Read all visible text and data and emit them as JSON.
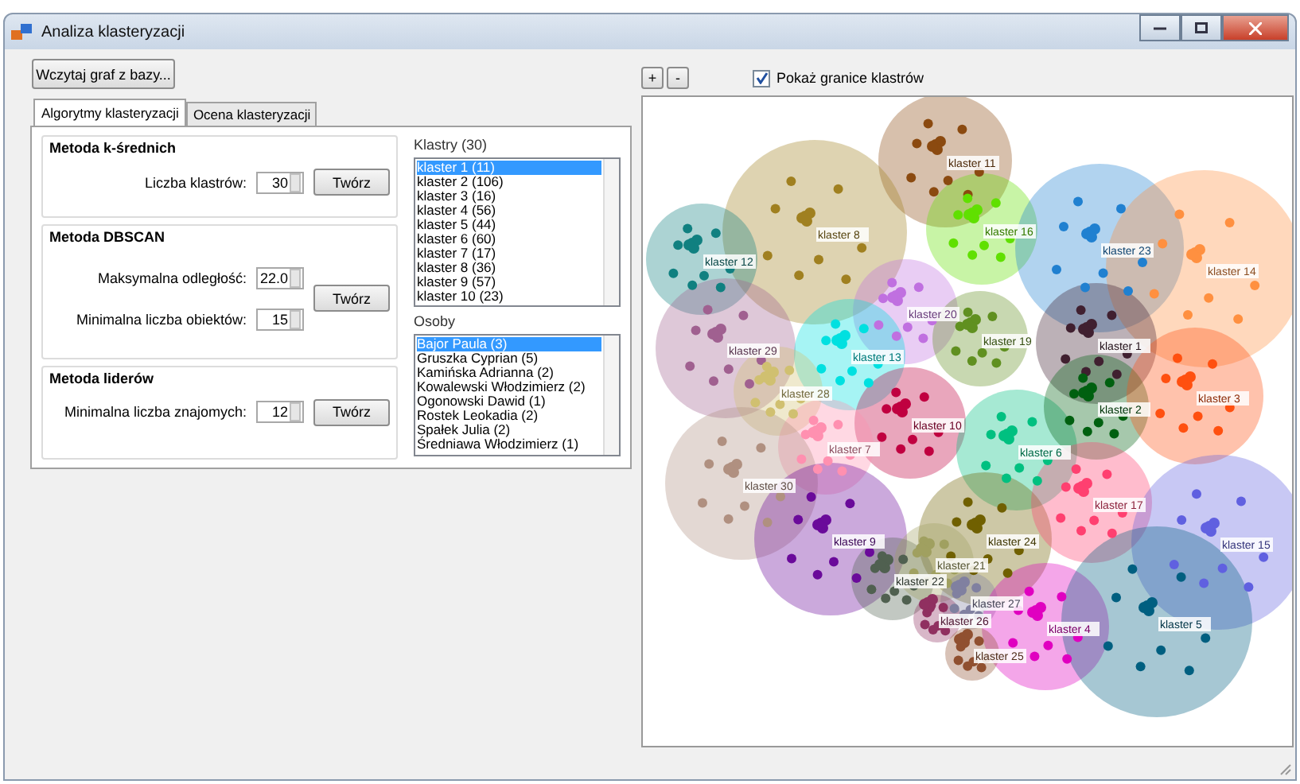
{
  "window": {
    "title": "Analiza klasteryzacji"
  },
  "load_button": "Wczytaj graf z bazy...",
  "tabs": [
    {
      "label": "Algorytmy klasteryzacji",
      "selected": true
    },
    {
      "label": "Ocena klasteryzacji",
      "selected": false
    }
  ],
  "methods": [
    {
      "title": "Metoda k-średnich",
      "fields": [
        {
          "label": "Liczba klastrów:",
          "value": "30"
        }
      ],
      "button": "Twórz"
    },
    {
      "title": "Metoda DBSCAN",
      "fields": [
        {
          "label": "Maksymalna odległość:",
          "value": "22.0"
        },
        {
          "label": "Minimalna liczba obiektów:",
          "value": "15"
        }
      ],
      "button": "Twórz"
    },
    {
      "title": "Metoda liderów",
      "fields": [
        {
          "label": "Minimalna liczba znajomych:",
          "value": "12"
        }
      ],
      "button": "Twórz"
    }
  ],
  "clusters_list": {
    "title": "Klastry (30)",
    "items": [
      {
        "label": "klaster 1 (11)",
        "selected": true
      },
      {
        "label": "klaster 2 (106)",
        "selected": false
      },
      {
        "label": "klaster 3 (16)",
        "selected": false
      },
      {
        "label": "klaster 4 (56)",
        "selected": false
      },
      {
        "label": "klaster 5 (44)",
        "selected": false
      },
      {
        "label": "klaster 6 (60)",
        "selected": false
      },
      {
        "label": "klaster 7 (17)",
        "selected": false
      },
      {
        "label": "klaster 8 (36)",
        "selected": false
      },
      {
        "label": "klaster 9 (57)",
        "selected": false
      },
      {
        "label": "klaster 10 (23)",
        "selected": false
      }
    ]
  },
  "people_list": {
    "title": "Osoby",
    "items": [
      {
        "label": "Bajor Paula (3)",
        "selected": true
      },
      {
        "label": "Gruszka Cyprian (5)",
        "selected": false
      },
      {
        "label": "Kamińska Adrianna (2)",
        "selected": false
      },
      {
        "label": "Kowalewski Włodzimierz (2)",
        "selected": false
      },
      {
        "label": "Ogonowski Dawid (1)",
        "selected": false
      },
      {
        "label": "Rostek Leokadia (2)",
        "selected": false
      },
      {
        "label": "Spałek Julia (2)",
        "selected": false
      },
      {
        "label": "Średniawa Włodzimierz (1)",
        "selected": false
      }
    ]
  },
  "zoom_buttons": [
    "+",
    "-"
  ],
  "show_borders": {
    "label": "Pokaż granice klastrów",
    "checked": true
  },
  "map": {
    "clusters": [
      {
        "label": "klaster 11",
        "color": "#8b4a10"
      },
      {
        "label": "klaster 8",
        "color": "#a08020"
      },
      {
        "label": "klaster 12",
        "color": "#108080"
      },
      {
        "label": "klaster 16",
        "color": "#60e000"
      },
      {
        "label": "klaster 23",
        "color": "#2080d0"
      },
      {
        "label": "klaster 14",
        "color": "#ff9040"
      },
      {
        "label": "klaster 20",
        "color": "#c070e0"
      },
      {
        "label": "klaster 19",
        "color": "#609020"
      },
      {
        "label": "klaster 29",
        "color": "#a06090"
      },
      {
        "label": "klaster 1",
        "color": "#402030"
      },
      {
        "label": "klaster 13",
        "color": "#00e0e0"
      },
      {
        "label": "klaster 28",
        "color": "#d0c070"
      },
      {
        "label": "klaster 10",
        "color": "#c00040"
      },
      {
        "label": "klaster 6",
        "color": "#00c080"
      },
      {
        "label": "klaster 2",
        "color": "#006010"
      },
      {
        "label": "klaster 3",
        "color": "#ff5010"
      },
      {
        "label": "klaster 7",
        "color": "#ff90b0"
      },
      {
        "label": "klaster 30",
        "color": "#b09080"
      },
      {
        "label": "klaster 9",
        "color": "#6a0a9a"
      },
      {
        "label": "klaster 24",
        "color": "#706000"
      },
      {
        "label": "klaster 17",
        "color": "#ff4070"
      },
      {
        "label": "klaster 15",
        "color": "#6060e0"
      },
      {
        "label": "klaster 22",
        "color": "#506050"
      },
      {
        "label": "klaster 21",
        "color": "#a0a060"
      },
      {
        "label": "klaster 27",
        "color": "#8080a0"
      },
      {
        "label": "klaster 26",
        "color": "#903060"
      },
      {
        "label": "klaster 4",
        "color": "#e000c0"
      },
      {
        "label": "klaster 5",
        "color": "#005f80"
      },
      {
        "label": "klaster 25",
        "color": "#905030"
      }
    ]
  }
}
